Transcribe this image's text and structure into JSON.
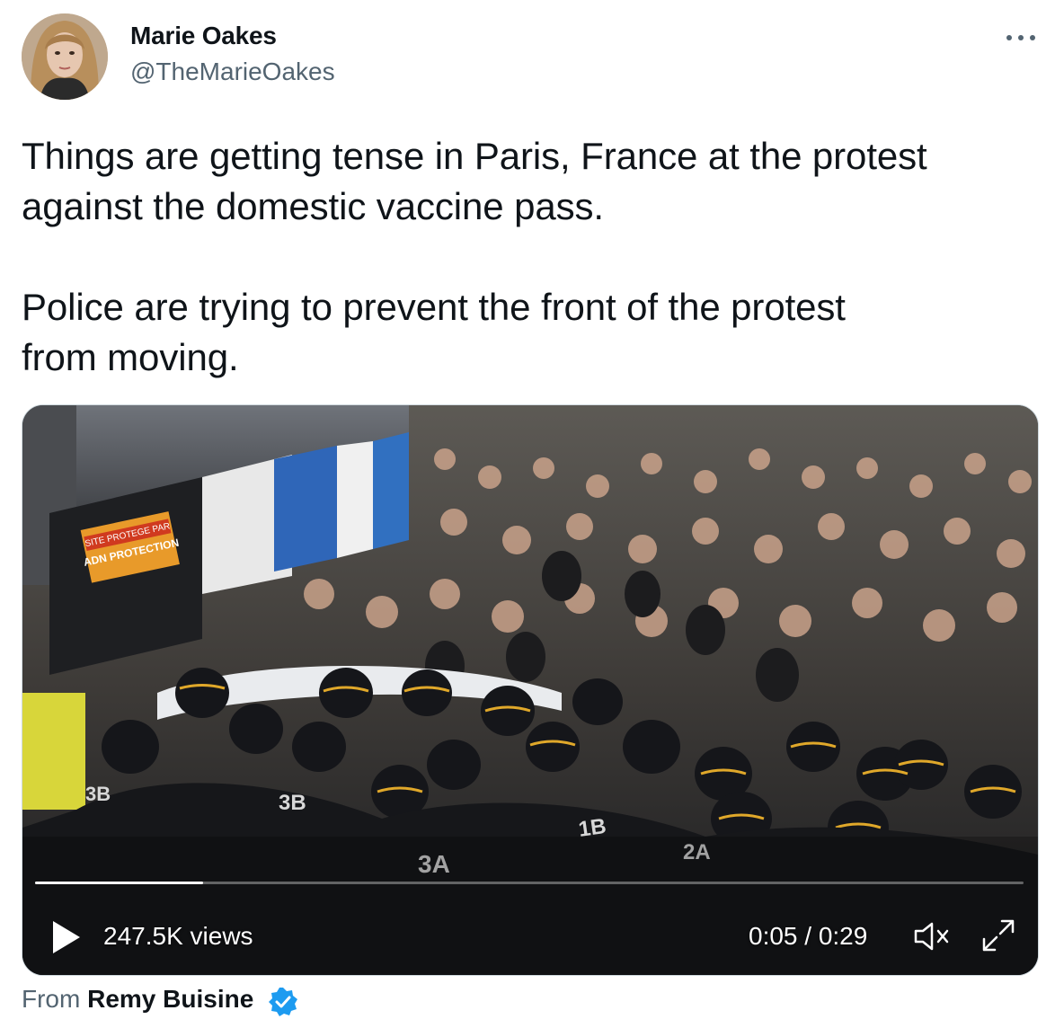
{
  "author": {
    "name": "Marie Oakes",
    "handle": "@TheMarieOakes"
  },
  "tweet": {
    "text": "Things are getting tense in Paris, France at the protest\nagainst the domestic vaccine pass.\n\nPolice are trying to prevent the front of the protest\nfrom moving."
  },
  "video": {
    "views": "247.5K views",
    "time": "0:05 / 0:29",
    "progress": 0.17,
    "overlay_text": {
      "sign_line1": "SITE PROTEGE PAR",
      "sign_line2": "ADN PROTECTION",
      "helmet_3A": "3A",
      "helmet_1B": "1B",
      "helmet_2A": "2A",
      "helmet_3B_left": "3B",
      "helmet_3B_mid": "3B"
    }
  },
  "source": {
    "from_label": "From",
    "from_name": "Remy Buisine"
  },
  "colors": {
    "text_primary": "#0f1419",
    "text_secondary": "#536471",
    "verified_blue": "#1d9bf0"
  },
  "icons": [
    "more-icon",
    "play-icon",
    "volume-muted-icon",
    "expand-icon",
    "verified-badge-icon"
  ]
}
